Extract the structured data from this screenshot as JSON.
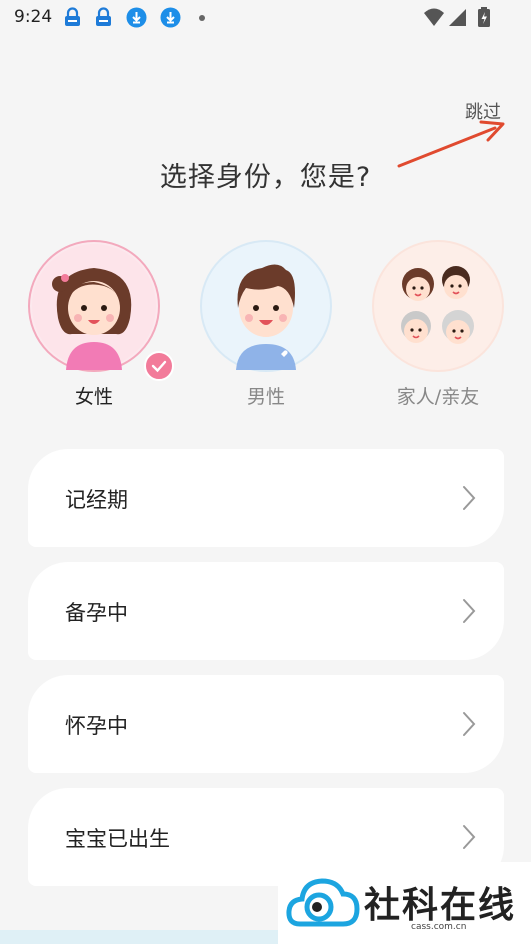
{
  "status_bar": {
    "time": "9:24",
    "icons": [
      "cloud-lock-icon",
      "cloud-lock-icon",
      "download-icon",
      "download-icon",
      "dot-icon",
      "wifi-icon",
      "signal-icon",
      "battery-icon"
    ]
  },
  "header": {
    "skip_label": "跳过",
    "title": "选择身份，您是?"
  },
  "roles": [
    {
      "label": "女性",
      "selected": true
    },
    {
      "label": "男性",
      "selected": false
    },
    {
      "label": "家人/亲友",
      "selected": false
    }
  ],
  "options": [
    {
      "label": "记经期"
    },
    {
      "label": "备孕中"
    },
    {
      "label": "怀孕中"
    },
    {
      "label": "宝宝已出生"
    }
  ],
  "watermark": {
    "brand": "社科在线",
    "domain": "cass.com.cn"
  },
  "colors": {
    "accent_pink": "#f27b9a",
    "arrow_red": "#e04a2f",
    "background": "#f5f5f5"
  }
}
